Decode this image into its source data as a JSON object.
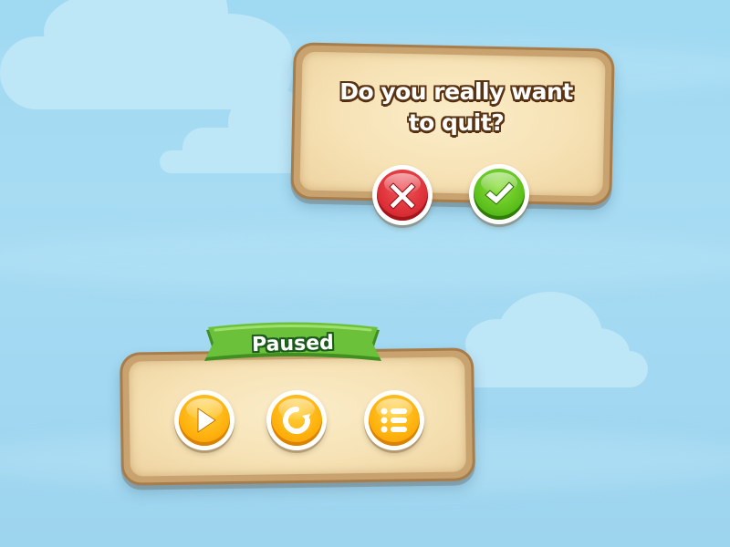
{
  "quit_dialog": {
    "line1": "Do you really want",
    "line2": "to quit?",
    "cancel_icon": "x-icon",
    "confirm_icon": "check-icon"
  },
  "pause_dialog": {
    "title": "Paused",
    "play_icon": "play-icon",
    "restart_icon": "restart-icon",
    "menu_icon": "menu-list-icon"
  },
  "colors": {
    "sky": "#a7dcf3",
    "panel_fill": "#f6e2b5",
    "panel_frame": "#a87d4c",
    "cancel_red": "#dc2f37",
    "confirm_green": "#5cbf1c",
    "action_orange": "#ffb20e",
    "ribbon_green": "#6cc13a"
  }
}
